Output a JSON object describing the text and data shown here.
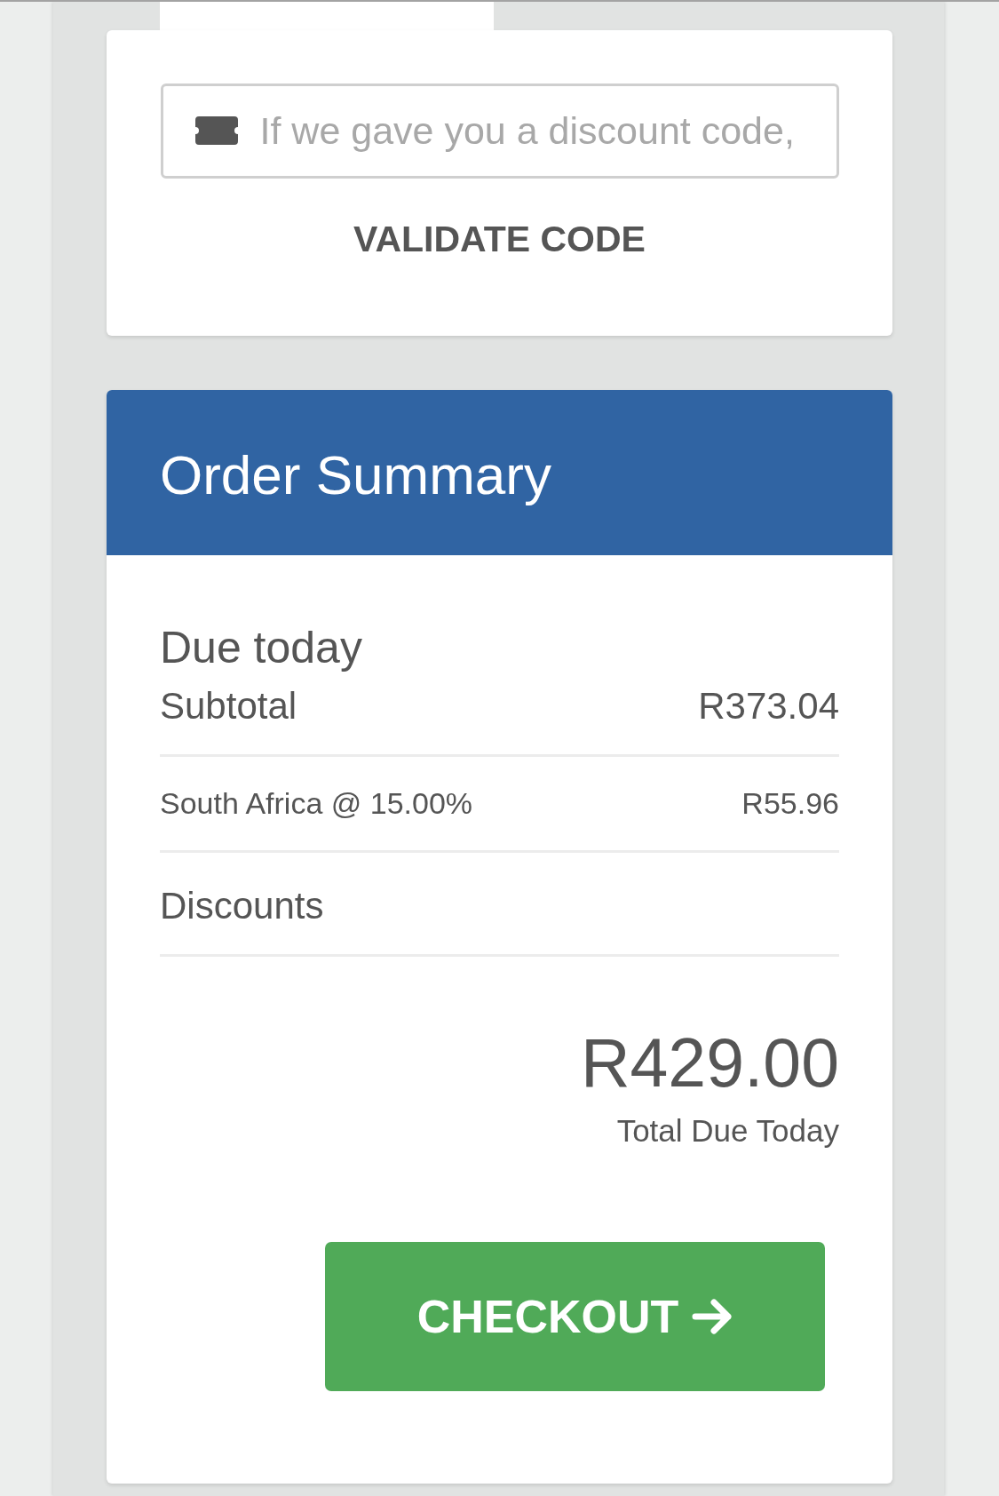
{
  "discount": {
    "placeholder": "If we gave you a discount code,",
    "button": "VALIDATE CODE"
  },
  "order_summary": {
    "title": "Order Summary",
    "section": "Due today",
    "lines": [
      {
        "kind": "main",
        "label": "Subtotal",
        "amount": "R373.04"
      },
      {
        "kind": "tax",
        "label": "South Africa @ 15.00%",
        "amount": "R55.96"
      },
      {
        "kind": "main",
        "label": "Discounts"
      }
    ],
    "total": {
      "amount": "R429.00",
      "label": "Total Due Today"
    },
    "checkout_button": "CHECKOUT"
  }
}
